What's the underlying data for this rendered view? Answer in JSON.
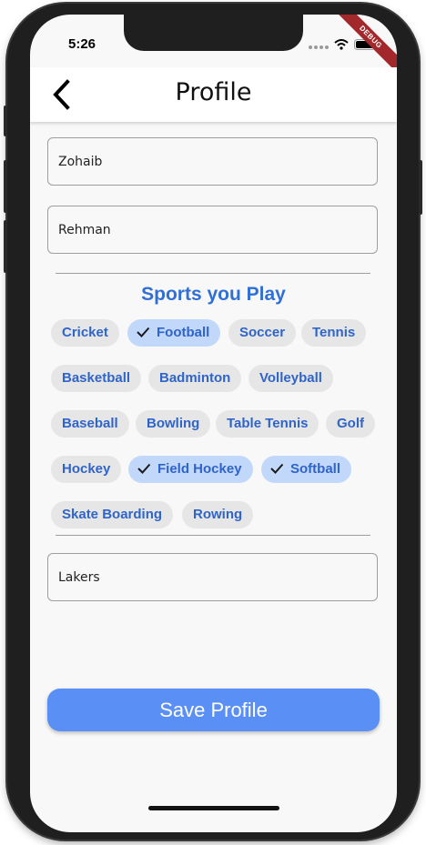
{
  "status_bar": {
    "time": "5:26",
    "debug_label": "DEBUG"
  },
  "app_bar": {
    "title": "Profile",
    "back_icon": "chevron-left-icon"
  },
  "form": {
    "first_name": "Zohaib",
    "last_name": "Rehman",
    "team": "Lakers"
  },
  "sports": {
    "title": "Sports you Play",
    "chips": [
      {
        "label": "Cricket",
        "selected": false
      },
      {
        "label": "Football",
        "selected": true
      },
      {
        "label": "Soccer",
        "selected": false
      },
      {
        "label": "Tennis",
        "selected": false
      },
      {
        "label": "Basketball",
        "selected": false
      },
      {
        "label": "Badminton",
        "selected": false
      },
      {
        "label": "Volleyball",
        "selected": false
      },
      {
        "label": "Baseball",
        "selected": false
      },
      {
        "label": "Bowling",
        "selected": false
      },
      {
        "label": "Table Tennis",
        "selected": false
      },
      {
        "label": "Golf",
        "selected": false
      },
      {
        "label": "Hockey",
        "selected": false
      },
      {
        "label": "Field Hockey",
        "selected": true
      },
      {
        "label": "Softball",
        "selected": true
      },
      {
        "label": "Skate Boarding",
        "selected": false
      },
      {
        "label": "Rowing",
        "selected": false
      }
    ]
  },
  "save_button": {
    "label": "Save Profile"
  },
  "colors": {
    "accent": "#2f6fd6",
    "chip_selected_bg": "#c2d8fb",
    "chip_bg": "#e6e6e6",
    "button_bg": "#5a8ff5"
  }
}
